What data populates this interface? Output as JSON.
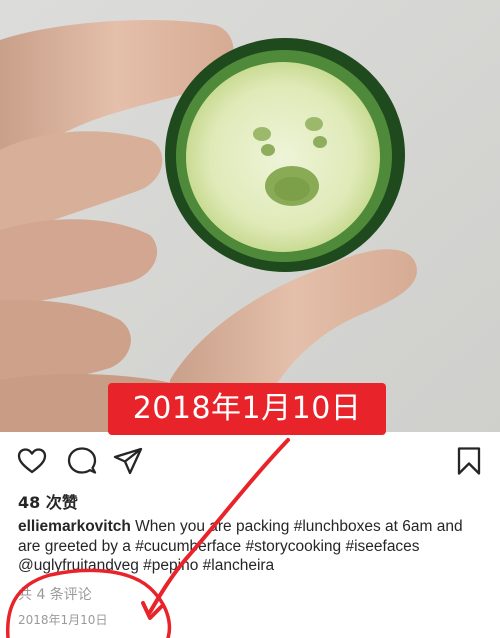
{
  "photo": {
    "subject": "cucumber-slice-with-face"
  },
  "annotation": {
    "date_label": "2018年1月10日",
    "color": "#e8232a"
  },
  "actions": {
    "like_icon": "heart-outline-icon",
    "comment_icon": "comment-bubble-icon",
    "share_icon": "paper-plane-icon",
    "save_icon": "bookmark-icon"
  },
  "post": {
    "likes": "48 次赞",
    "username": "elliemarkovitch",
    "caption_parts": [
      " When you are packing ",
      "#lunchboxes",
      " at 6am and are greeted by a ",
      "#cucumberface",
      " ",
      "#storycooking",
      " ",
      "#iseefaces",
      " ",
      "@uglyfruitandveg",
      " ",
      "#pepino",
      " ",
      "#lancheira"
    ],
    "comments": "共 4 条评论",
    "date": "2018年1月10日"
  }
}
